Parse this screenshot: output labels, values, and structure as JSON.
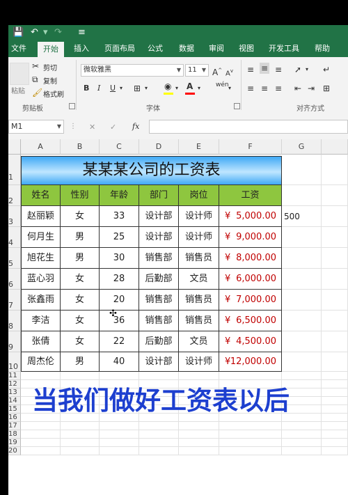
{
  "quick_access": {
    "save_icon": "save-icon",
    "undo_icon": "undo-icon",
    "redo_icon": "redo-icon",
    "customize_icon": "customize-icon"
  },
  "tabs": [
    "文件",
    "开始",
    "插入",
    "页面布局",
    "公式",
    "数据",
    "审阅",
    "视图",
    "开发工具",
    "帮助"
  ],
  "active_tab": "开始",
  "ribbon": {
    "clipboard": {
      "paste": "粘贴",
      "cut": "剪切",
      "copy": "复制",
      "format_painter": "格式刷",
      "group": "剪贴板"
    },
    "font": {
      "name": "微软雅黑",
      "size": "11",
      "grow": "A",
      "shrink": "A",
      "bold": "B",
      "italic": "I",
      "underline": "U",
      "wen": "wén",
      "group": "字体"
    },
    "alignment": {
      "group": "对齐方式"
    }
  },
  "formula_bar": {
    "name_box": "M1",
    "cancel": "✕",
    "enter": "✓",
    "fx": "fx",
    "value": ""
  },
  "columns": [
    "A",
    "B",
    "C",
    "D",
    "E",
    "F",
    "G"
  ],
  "rows": [
    "1",
    "2",
    "3",
    "4",
    "5",
    "6",
    "7",
    "8",
    "9",
    "10",
    "11",
    "12",
    "13",
    "14",
    "15",
    "16",
    "17",
    "18",
    "19",
    "20"
  ],
  "sheet": {
    "title": "某某某公司的工资表",
    "headers": [
      "姓名",
      "性别",
      "年龄",
      "部门",
      "岗位",
      "工资"
    ],
    "currency": "¥",
    "records": [
      {
        "name": "赵丽颖",
        "gender": "女",
        "age": "33",
        "dept": "设计部",
        "post": "设计师",
        "salary": "5,000.00"
      },
      {
        "name": "何月生",
        "gender": "男",
        "age": "25",
        "dept": "设计部",
        "post": "设计师",
        "salary": "9,000.00"
      },
      {
        "name": "旭花生",
        "gender": "男",
        "age": "30",
        "dept": "销售部",
        "post": "销售员",
        "salary": "8,000.00"
      },
      {
        "name": "蓝心羽",
        "gender": "女",
        "age": "28",
        "dept": "后勤部",
        "post": "文员",
        "salary": "6,000.00"
      },
      {
        "name": "张鑫雨",
        "gender": "女",
        "age": "20",
        "dept": "销售部",
        "post": "销售员",
        "salary": "7,000.00"
      },
      {
        "name": "李洁",
        "gender": "女",
        "age": "36",
        "dept": "销售部",
        "post": "销售员",
        "salary": "6,500.00"
      },
      {
        "name": "张倩",
        "gender": "女",
        "age": "22",
        "dept": "后勤部",
        "post": "文员",
        "salary": "4,500.00"
      },
      {
        "name": "周杰伦",
        "gender": "男",
        "age": "40",
        "dept": "设计部",
        "post": "设计师",
        "salary": "12,000.00"
      }
    ],
    "g3": "500"
  },
  "caption": "当我们做好工资表以后",
  "colors": {
    "excel_green": "#217346",
    "header_fill": "#8ec63f",
    "money_red": "#c00000",
    "caption_blue": "#1d3fcf",
    "title_blue": "#3fa9f5"
  }
}
